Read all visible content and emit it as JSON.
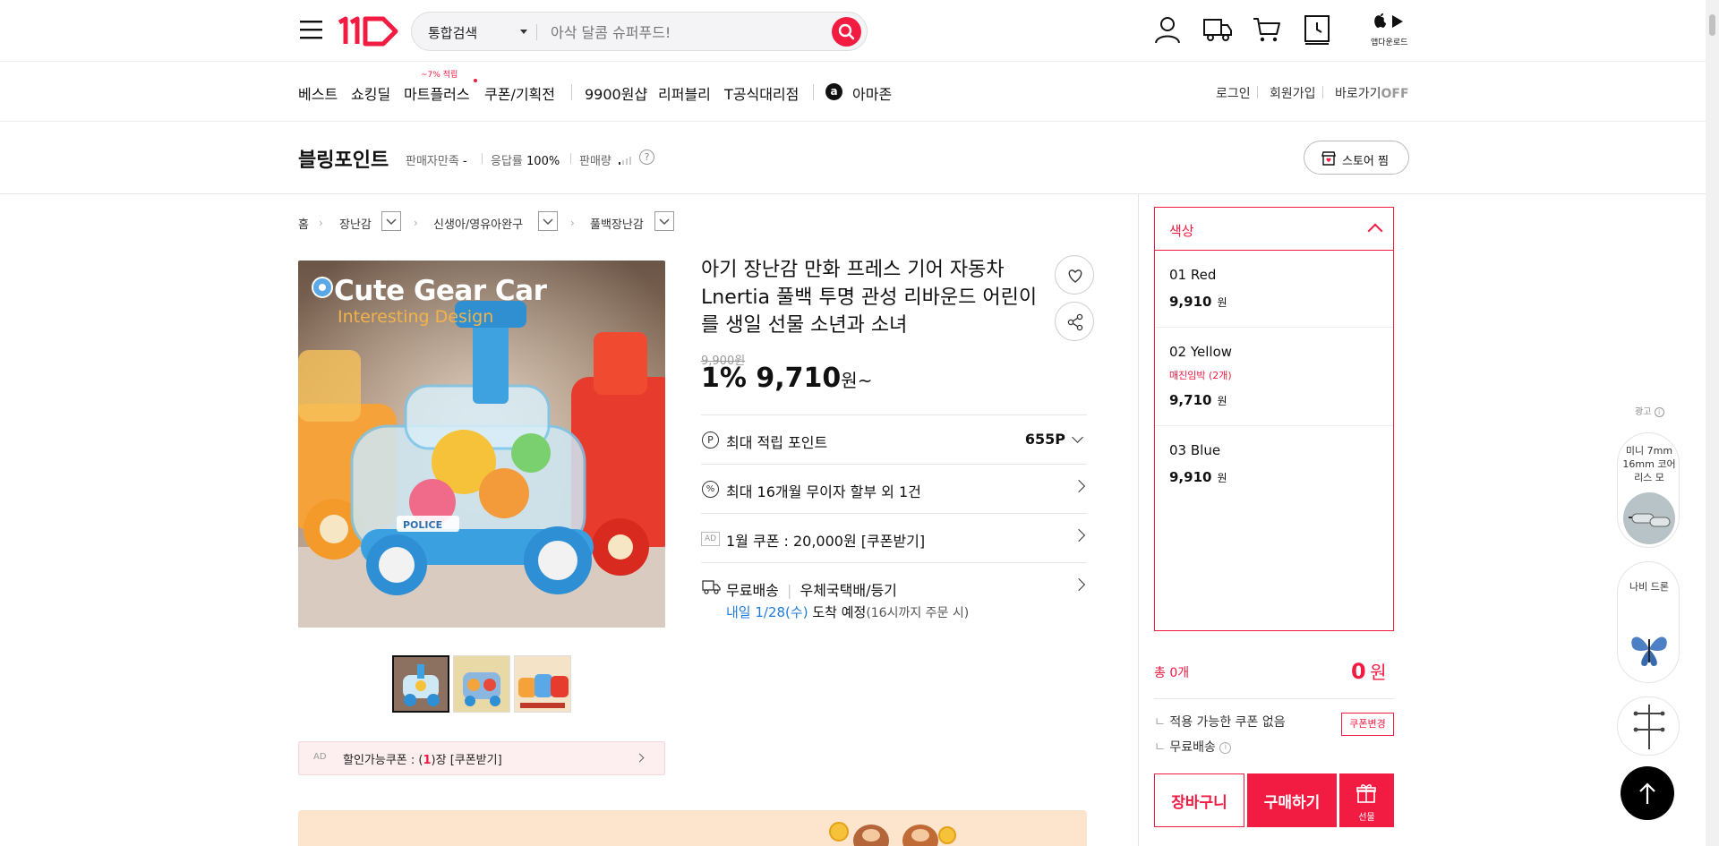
{
  "header": {
    "search": {
      "scope": "통합검색",
      "placeholder": "아삭 달콤 슈퍼푸드!"
    },
    "app_download": "앱다운로드"
  },
  "nav": {
    "items": [
      "베스트",
      "쇼킹딜",
      "마트플러스",
      "쿠폰/기획전",
      "9900원샵",
      "리퍼블리",
      "T공식대리점",
      "아마존"
    ],
    "mart_badge": "~7% 적립",
    "right": {
      "login": "로그인",
      "signup": "회원가입",
      "shortcut": "바로가기",
      "shortcut_state": "OFF"
    }
  },
  "store": {
    "name": "블링포인트",
    "satisfaction_label": "판매자만족",
    "satisfaction_value": "-",
    "response_label": "응답률",
    "response_value": "100%",
    "sales_label": "판매량",
    "follow_button": "스토어 찜"
  },
  "breadcrumb": [
    "홈",
    "장난감",
    "신생아/영유아완구",
    "풀백장난감"
  ],
  "product": {
    "title": "아기 장난감 만화 프레스 기어 자동차 Lnertia 풀백 투명 관성 리바운드 어린이를 생일 선물 소년과 소녀",
    "image_text_main": "Cute Gear Car",
    "image_text_sub": "Interesting Design",
    "image_plate": "POLICE",
    "original_price": "9,900원",
    "discount": "1%",
    "price": "9,710",
    "price_unit": "원~",
    "info_rows": [
      {
        "text": "최대 적립 포인트",
        "value": "655P"
      },
      {
        "text": "최대 16개월 무이자 할부 외 1건"
      },
      {
        "ad": "AD",
        "text": "1월 쿠폰 : 20,000원 [쿠폰받기]"
      },
      {
        "shipping_free": "무료배송",
        "shipping_method": "우체국택배/등기",
        "arrival_date": "내일 1/28(수)",
        "arrival_text": "도착 예정",
        "arrival_note": "(16시까지 주문 시)"
      }
    ],
    "coupon_bar": {
      "ad": "AD",
      "text_prefix": "할인가능쿠폰 : (",
      "count": "1",
      "text_suffix": ")장 [쿠폰받기]"
    }
  },
  "options": {
    "header": "색상",
    "items": [
      {
        "name": "01 Red",
        "price": "9,910",
        "unit": "원"
      },
      {
        "name": "02 Yellow",
        "badge": "매진임박 (2개)",
        "price": "9,710",
        "unit": "원"
      },
      {
        "name": "03 Blue",
        "price": "9,910",
        "unit": "원"
      }
    ]
  },
  "order": {
    "total_label": "총 0개",
    "total_amount": "0",
    "total_unit": "원",
    "coupon_text": "적용 가능한 쿠폰 없음",
    "coupon_change": "쿠폰변경",
    "shipping": "무료배송",
    "cart_button": "장바구니",
    "buy_button": "구매하기",
    "gift_button": "선물"
  },
  "ads": {
    "label": "광고",
    "items": [
      {
        "text": "미니 7mm 16mm 코어리스 모"
      },
      {
        "text": "나비 드론"
      },
      {
        "text": ""
      }
    ]
  },
  "colors": {
    "brand": "#f21b42",
    "link_blue": "#1e7bd9"
  }
}
